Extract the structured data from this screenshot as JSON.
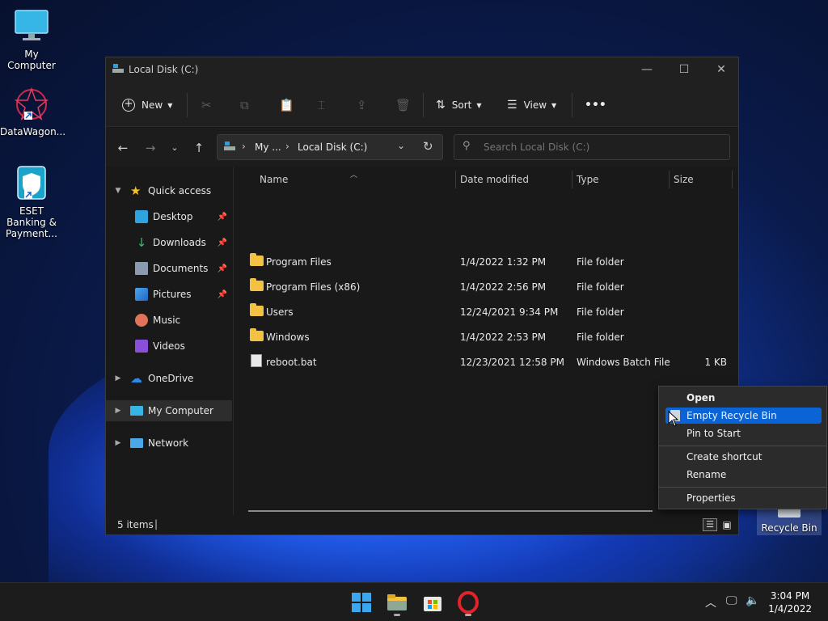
{
  "desktop": {
    "icons": [
      {
        "label": "My Computer"
      },
      {
        "label": "DataWagon..."
      },
      {
        "label": "ESET Banking & Payment..."
      },
      {
        "label": "Recycle Bin"
      }
    ]
  },
  "window": {
    "title": "Local Disk (C:)",
    "toolbar": {
      "new_label": "New",
      "sort_label": "Sort",
      "view_label": "View",
      "more_label": "•••"
    },
    "address": {
      "crumbs": [
        "My ...",
        "Local Disk (C:)"
      ]
    },
    "search": {
      "placeholder": "Search Local Disk (C:)"
    },
    "sidebar": {
      "quick_access": "Quick access",
      "items": [
        {
          "label": "Desktop"
        },
        {
          "label": "Downloads"
        },
        {
          "label": "Documents"
        },
        {
          "label": "Pictures"
        },
        {
          "label": "Music"
        },
        {
          "label": "Videos"
        }
      ],
      "onedrive": "OneDrive",
      "my_computer": "My Computer",
      "network": "Network"
    },
    "columns": {
      "name": "Name",
      "date": "Date modified",
      "type": "Type",
      "size": "Size"
    },
    "files": [
      {
        "name": "Program Files",
        "date": "1/4/2022 1:32 PM",
        "type": "File folder",
        "size": ""
      },
      {
        "name": "Program Files (x86)",
        "date": "1/4/2022 2:56 PM",
        "type": "File folder",
        "size": ""
      },
      {
        "name": "Users",
        "date": "12/24/2021 9:34 PM",
        "type": "File folder",
        "size": ""
      },
      {
        "name": "Windows",
        "date": "1/4/2022 2:53 PM",
        "type": "File folder",
        "size": ""
      },
      {
        "name": "reboot.bat",
        "date": "12/23/2021 12:58 PM",
        "type": "Windows Batch File",
        "size": "1 KB"
      }
    ],
    "status": {
      "count": "5 items"
    }
  },
  "context_menu": {
    "items": [
      {
        "label": "Open"
      },
      {
        "label": "Empty Recycle Bin"
      },
      {
        "label": "Pin to Start"
      },
      {
        "label": "Create shortcut"
      },
      {
        "label": "Rename"
      },
      {
        "label": "Properties"
      }
    ]
  },
  "taskbar": {
    "time": "3:04 PM",
    "date": "1/4/2022"
  },
  "colors": {
    "accent": "#0a64d6",
    "folder": "#f3c244",
    "window_bg": "#191919"
  }
}
